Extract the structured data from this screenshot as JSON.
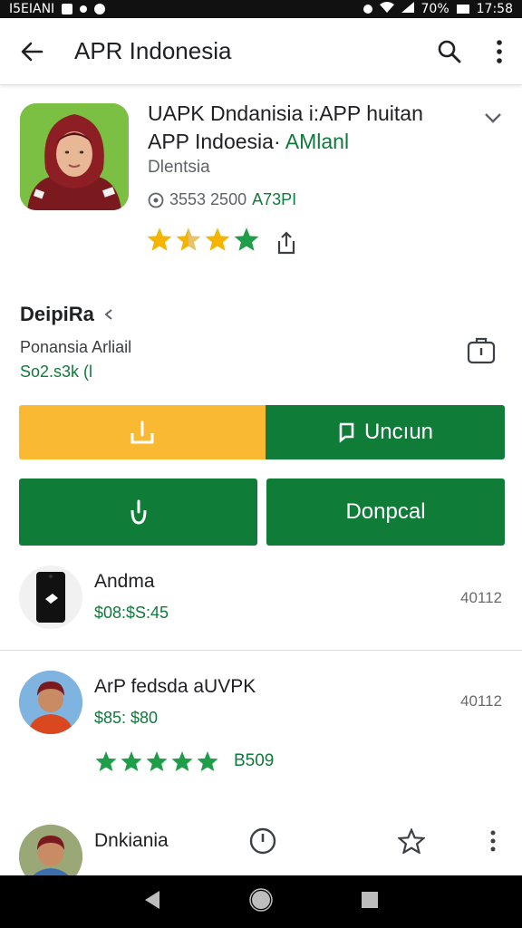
{
  "status": {
    "left_text": "I5EIANI",
    "battery": "70%",
    "time": "17:58"
  },
  "app_bar": {
    "title": "APR Indonesia"
  },
  "header": {
    "app_name_line1": "UAPK Dndanisia i:APP huitan",
    "app_name_line2_plain": "APP Indoesia·",
    "app_name_line2_accent": "AMlanl",
    "developer": "Dlentsia",
    "meta_plain": "3553 2500",
    "meta_accent": "A73PI",
    "rating": 4.5
  },
  "section": {
    "title": "DeipiRa",
    "subtitle": "Ponansia Arliail",
    "size": "So2.s3k (l"
  },
  "buttons": {
    "uninstall_label": "Uncıun",
    "open_label": "Donpcal"
  },
  "list": [
    {
      "title": "Andma",
      "price": "$08:$S:45",
      "code": "40112"
    },
    {
      "title": "ArP fedsda aUVPK",
      "price": "$85: $80",
      "code": "40112",
      "stars_label": "B509"
    },
    {
      "title": "Dnkiania"
    }
  ],
  "colors": {
    "green": "#0f7c38",
    "accent_green": "#0f7a3b",
    "yellow": "#f9b933",
    "star_yellow": "#f4b400",
    "star_green": "#1e9e48"
  },
  "icons": [
    "back-arrow-icon",
    "search-icon",
    "more-vert-icon",
    "chevron-down-icon",
    "share-icon",
    "wishlist-icon",
    "download-icon",
    "open-icon",
    "touch-icon",
    "timer-icon",
    "star-outline-icon"
  ]
}
